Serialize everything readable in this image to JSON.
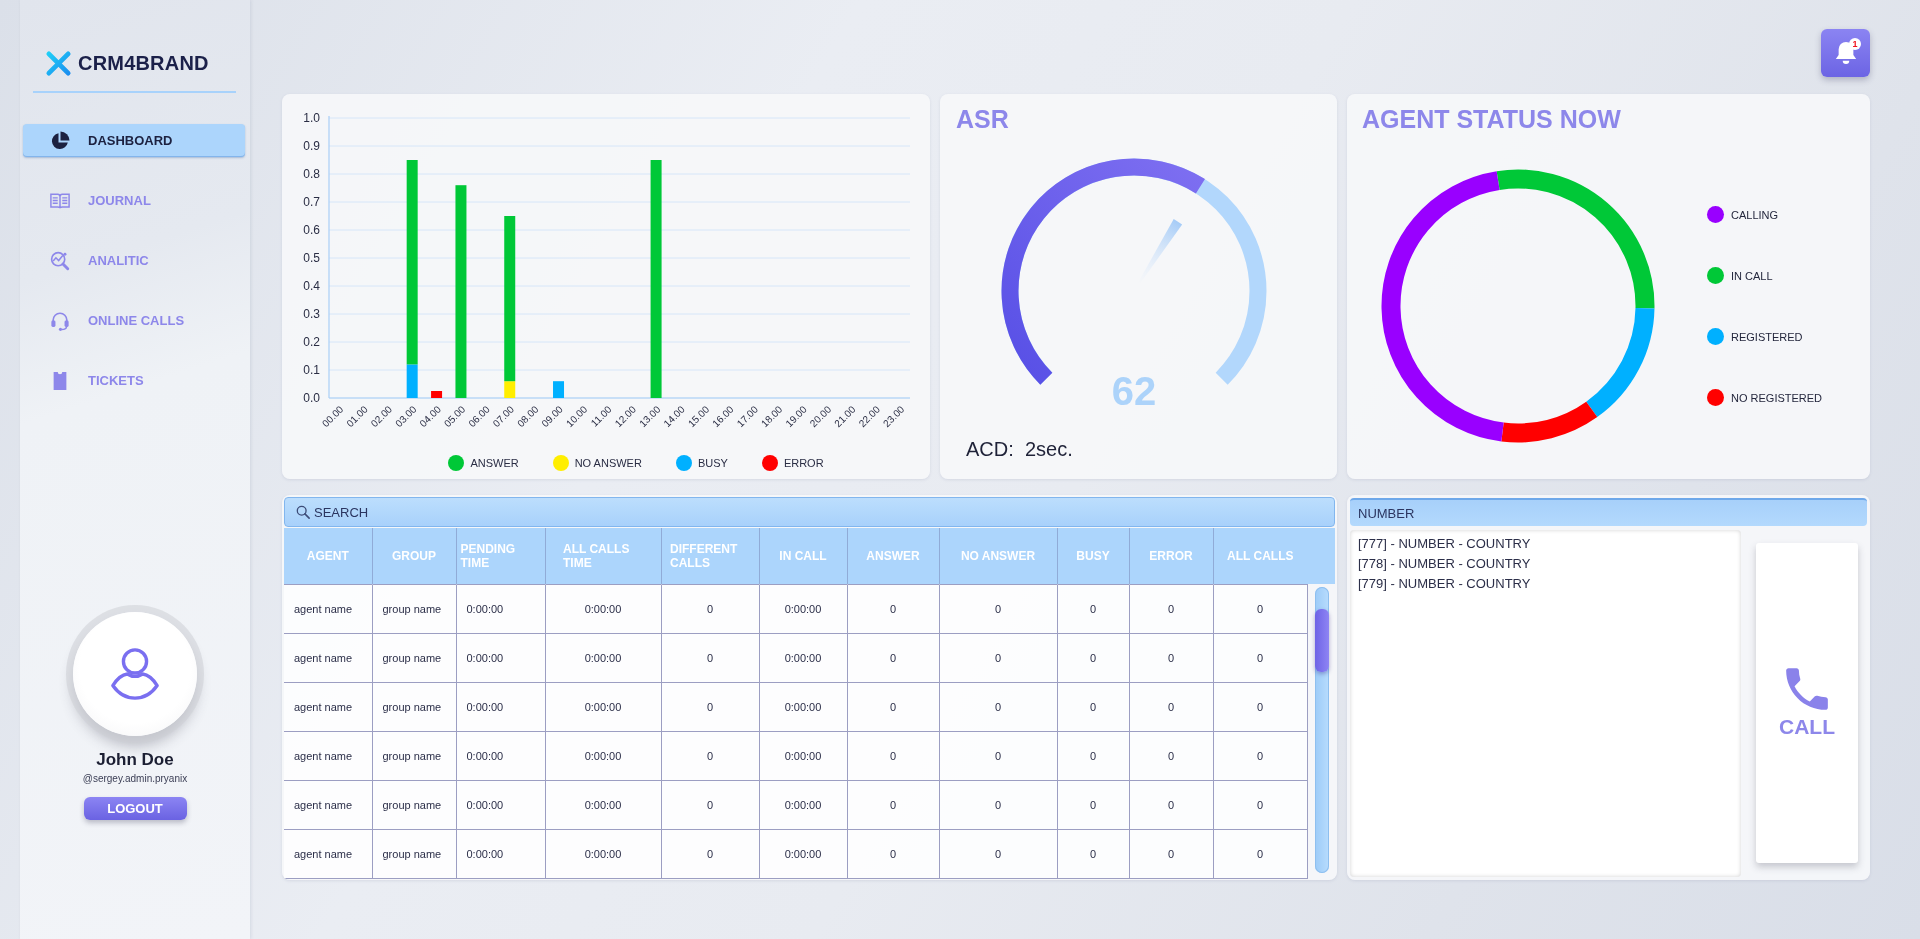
{
  "logo": {
    "text": "CRM4BRAND"
  },
  "nav": [
    {
      "label": "DASHBOARD",
      "selected": true
    },
    {
      "label": "JOURNAL",
      "selected": false
    },
    {
      "label": "ANALITIC",
      "selected": false
    },
    {
      "label": "ONLINE CALLS",
      "selected": false
    },
    {
      "label": "TICKETS",
      "selected": false
    }
  ],
  "user": {
    "name": "John Doe",
    "handle": "@sergey.admin.pryanix",
    "logout": "LOGOUT"
  },
  "notifications": {
    "count": "1"
  },
  "calls_chart": {
    "chart_data": {
      "type": "bar",
      "categories": [
        "00.00",
        "01.00",
        "02.00",
        "03.00",
        "04.00",
        "05.00",
        "06.00",
        "07.00",
        "08.00",
        "09.00",
        "10.00",
        "11.00",
        "12.00",
        "13.00",
        "14.00",
        "15.00",
        "16.00",
        "17.00",
        "18.00",
        "19.00",
        "20.00",
        "21.00",
        "22.00",
        "23.00"
      ],
      "series": [
        {
          "name": "ANSWER",
          "color": "#00c837",
          "values": [
            0,
            0,
            0,
            0.73,
            0,
            0.76,
            0,
            0.59,
            0,
            0,
            0,
            0,
            0,
            0.85,
            0,
            0,
            0,
            0,
            0,
            0,
            0,
            0,
            0,
            0
          ]
        },
        {
          "name": "NO ANSWER",
          "color": "#ffee00",
          "values": [
            0,
            0,
            0,
            0,
            0,
            0,
            0,
            0.06,
            0,
            0,
            0,
            0,
            0,
            0,
            0,
            0,
            0,
            0,
            0,
            0,
            0,
            0,
            0,
            0
          ]
        },
        {
          "name": "BUSY",
          "color": "#00b0ff",
          "values": [
            0,
            0,
            0,
            0.12,
            0,
            0,
            0,
            0,
            0,
            0.06,
            0,
            0,
            0,
            0,
            0,
            0,
            0,
            0,
            0,
            0,
            0,
            0,
            0,
            0
          ]
        },
        {
          "name": "ERROR",
          "color": "#ff0000",
          "values": [
            0,
            0,
            0,
            0,
            0.025,
            0,
            0,
            0,
            0,
            0,
            0,
            0,
            0,
            0,
            0,
            0,
            0,
            0,
            0,
            0,
            0,
            0,
            0,
            0
          ]
        }
      ],
      "ylim": [
        0,
        1
      ],
      "yticks": [
        {
          "value": 0,
          "label": "0.0"
        },
        {
          "value": 0.1,
          "label": "0.1"
        },
        {
          "value": 0.2,
          "label": "0.2"
        },
        {
          "value": 0.3,
          "label": "0.3"
        },
        {
          "value": 0.4,
          "label": "0.4"
        },
        {
          "value": 0.5,
          "label": "0.5"
        },
        {
          "value": 0.6,
          "label": "0.6"
        },
        {
          "value": 0.7,
          "label": "0.7"
        },
        {
          "value": 0.8,
          "label": "0.8"
        },
        {
          "value": 0.9,
          "label": "0.9"
        },
        {
          "value": 1,
          "label": "1.0"
        }
      ],
      "stacked": true,
      "grid": true
    }
  },
  "asr": {
    "title": "ASR",
    "value": "62",
    "level": 0.62,
    "acd": "ACD:  2sec."
  },
  "agent_status": {
    "title": "AGENT STATUS NOW",
    "legend": [
      {
        "label": "CALLING",
        "color": "#9900ff"
      },
      {
        "label": "IN CALL",
        "color": "#00c837"
      },
      {
        "label": "REGISTERED",
        "color": "#00b0ff"
      },
      {
        "label": "NO REGISTERED",
        "color": "#ff0000"
      }
    ]
  },
  "table": {
    "search": {
      "placeholder": "SEARCH"
    },
    "columns": [
      "AGENT",
      "GROUP",
      "PENDING TIME",
      "ALL CALLS TIME",
      "DIFFERENT CALLS",
      "IN CALL",
      "ANSWER",
      "NO ANSWER",
      "BUSY",
      "ERROR",
      "ALL CALLS"
    ],
    "rows": [
      [
        "agent name",
        "group name",
        "0:00:00",
        "0:00:00",
        "0",
        "0:00:00",
        "0",
        "0",
        "0",
        "0",
        "0"
      ],
      [
        "agent name",
        "group name",
        "0:00:00",
        "0:00:00",
        "0",
        "0:00:00",
        "0",
        "0",
        "0",
        "0",
        "0"
      ],
      [
        "agent name",
        "group name",
        "0:00:00",
        "0:00:00",
        "0",
        "0:00:00",
        "0",
        "0",
        "0",
        "0",
        "0"
      ],
      [
        "agent name",
        "group name",
        "0:00:00",
        "0:00:00",
        "0",
        "0:00:00",
        "0",
        "0",
        "0",
        "0",
        "0"
      ],
      [
        "agent name",
        "group name",
        "0:00:00",
        "0:00:00",
        "0",
        "0:00:00",
        "0",
        "0",
        "0",
        "0",
        "0"
      ],
      [
        "agent name",
        "group name",
        "0:00:00",
        "0:00:00",
        "0",
        "0:00:00",
        "0",
        "0",
        "0",
        "0",
        "0"
      ]
    ]
  },
  "numbers": {
    "header": "NUMBER",
    "items": [
      "[777] - NUMBER - COUNTRY",
      "[778] - NUMBER - COUNTRY",
      "[779] - NUMBER - COUNTRY"
    ],
    "call_button": "CALL"
  }
}
